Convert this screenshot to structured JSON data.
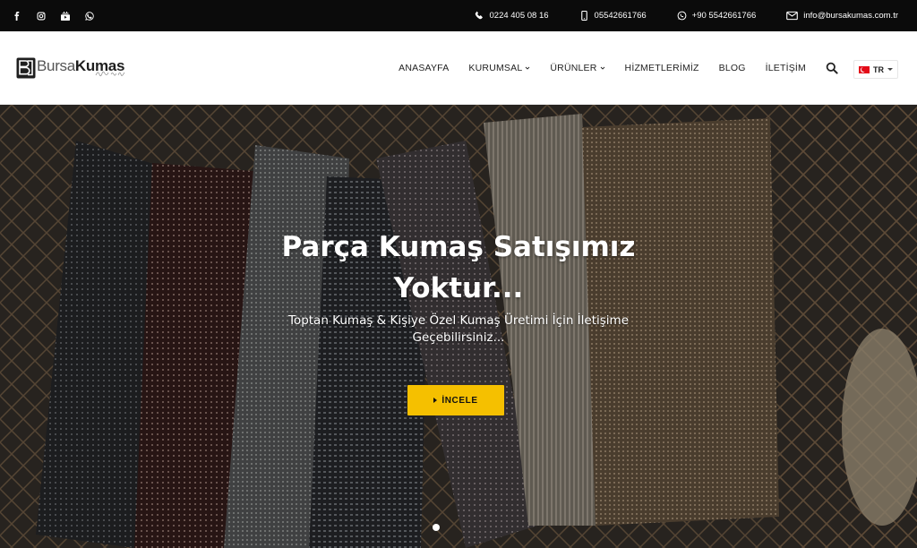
{
  "topbar": {
    "social": [
      {
        "icon": "facebook-icon"
      },
      {
        "icon": "instagram-icon"
      },
      {
        "icon": "youtube-icon"
      },
      {
        "icon": "whatsapp-icon"
      }
    ],
    "phone": "0224 405 08 16",
    "mobile": "05542661766",
    "whatsapp": "+90 5542661766",
    "email": "info@bursakumas.com.tr"
  },
  "header": {
    "logo_part1": "Bursa",
    "logo_part2": "Kumas",
    "nav": [
      {
        "label": "ANASAYFA",
        "dropdown": false
      },
      {
        "label": "KURUMSAL",
        "dropdown": true
      },
      {
        "label": "ÜRÜNLER",
        "dropdown": true
      },
      {
        "label": "HİZMETLERİMİZ",
        "dropdown": false
      },
      {
        "label": "BLOG",
        "dropdown": false
      },
      {
        "label": "İLETİŞİM",
        "dropdown": false
      }
    ],
    "language": "TR"
  },
  "hero": {
    "title": "Parça Kumaş Satışımız Yoktur...",
    "subtitle": "Toptan Kumaş & Kişiye Özel Kumaş Üretimi İçin İletişime Geçebilirsiniz...",
    "cta_label": "İNCELE",
    "active_slide": 1,
    "slide_count": 1
  },
  "colors": {
    "topbar_bg": "#0b0b0b",
    "accent": "#f5c000",
    "text_dark": "#222222"
  }
}
